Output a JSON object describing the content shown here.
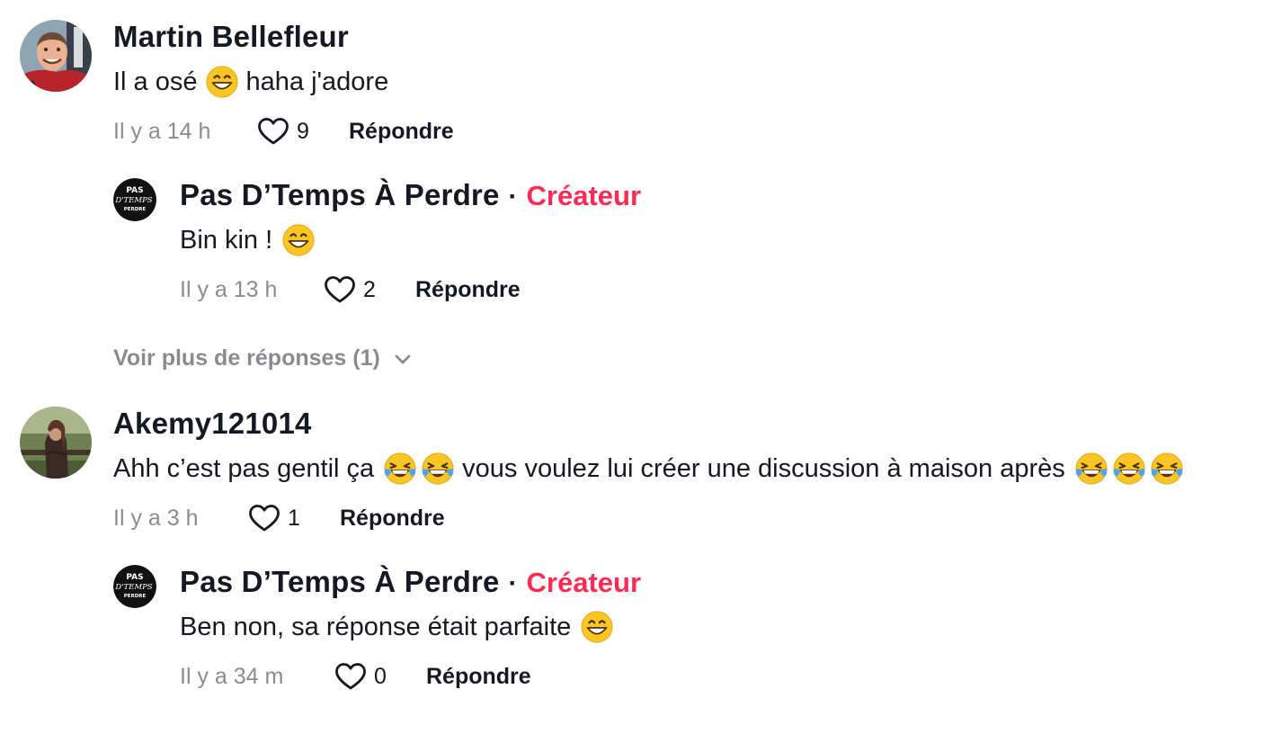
{
  "comments": [
    {
      "author": "Martin Bellefleur",
      "text_before": "Il a osé",
      "text_after": "haha j'adore",
      "time": "Il y a 14 h",
      "likes": "9",
      "reply_label": "Répondre",
      "reply": {
        "author": "Pas D’Temps À Perdre",
        "separator": "·",
        "badge": "Créateur",
        "text": "Bin kin !",
        "time": "Il y a 13 h",
        "likes": "2",
        "reply_label": "Répondre"
      }
    },
    {
      "author": "Akemy121014",
      "text_before": "Ahh c’est pas gentil ça",
      "text_after": "vous voulez lui créer une discussion à maison après",
      "time": "Il y a 3 h",
      "likes": "1",
      "reply_label": "Répondre",
      "reply": {
        "author": "Pas D’Temps À Perdre",
        "separator": "·",
        "badge": "Créateur",
        "text": "Ben non, sa réponse était parfaite",
        "time": "Il y a 34 m",
        "likes": "0",
        "reply_label": "Répondre"
      }
    }
  ],
  "more_replies": "Voir plus de réponses (1)",
  "creator_logo": {
    "line1": "PAS",
    "line2": "D'TEMPS",
    "line3": "PERDRE"
  },
  "icons": {
    "like": "heart-outline-icon",
    "expand": "chevron-down-icon",
    "grin": "grinning-face-emoji",
    "laugh": "tears-of-joy-emoji"
  },
  "colors": {
    "creator_badge": "#fe2c55",
    "muted": "#8a8b91",
    "text": "#161823"
  }
}
